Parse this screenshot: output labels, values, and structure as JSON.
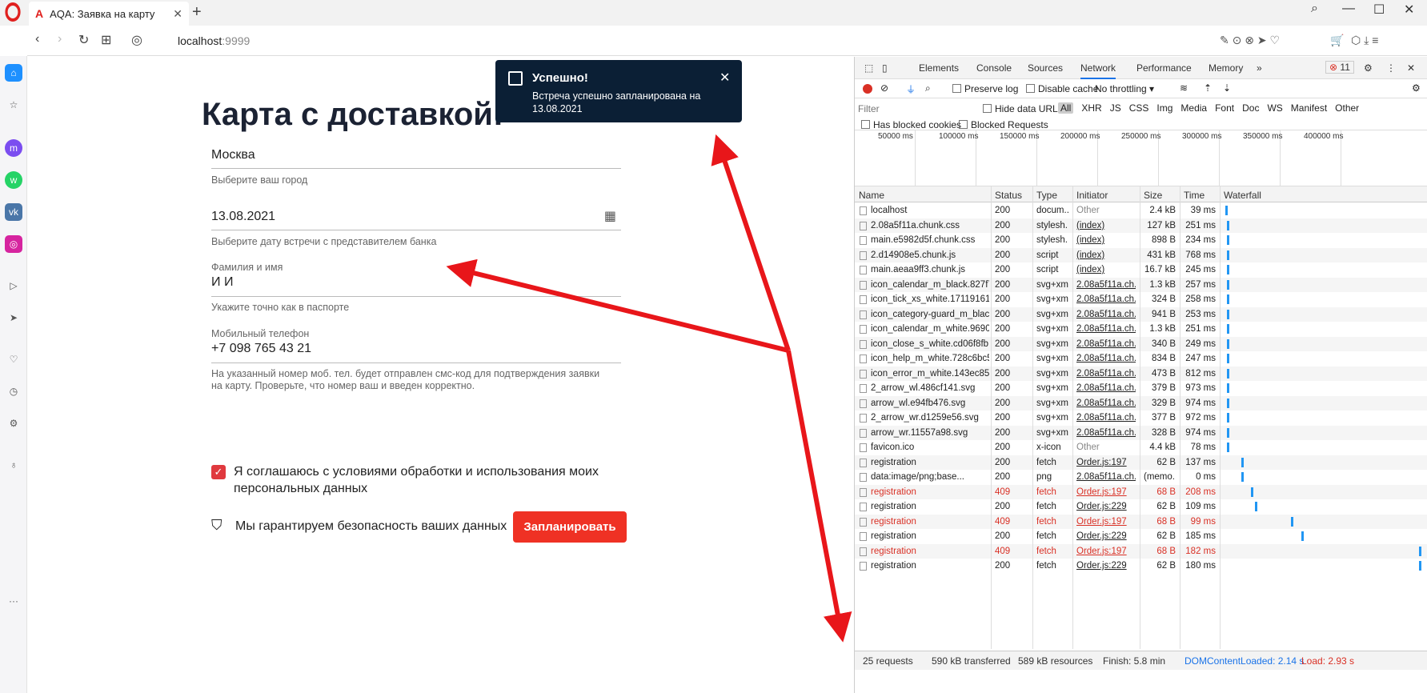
{
  "browser": {
    "tab_title": "AQA: Заявка на карту",
    "tab_close": "✕",
    "new_tab": "+",
    "url_host": "localhost",
    "url_port": ":9999"
  },
  "form": {
    "title": "Карта с доставкой!",
    "city_value": "Москва",
    "city_hint": "Выберите ваш город",
    "date_value": "13.08.2021",
    "date_hint": "Выберите дату встречи с представителем банка",
    "name_label": "Фамилия и имя",
    "name_value": "И И",
    "name_hint": "Укажите точно как в паспорте",
    "phone_label": "Мобильный телефон",
    "phone_value": "+7 098 765 43 21",
    "phone_hint": "На указанный номер моб. тел. будет отправлен смс-код для подтверждения заявки на карту. Проверьте, что номер ваш и введен корректно.",
    "agree_text": "Я соглашаюсь с условиями обработки и использования моих персональных данных",
    "secure_text": "Мы гарантируем безопасность ваших данных",
    "submit_label": "Запланировать"
  },
  "toast": {
    "title": "Успешно!",
    "message": "Встреча успешно запланирована на 13.08.2021"
  },
  "devtools": {
    "tabs": [
      "Elements",
      "Console",
      "Sources",
      "Network",
      "Performance",
      "Memory"
    ],
    "active_tab": "Network",
    "more": "»",
    "errors_count": "11",
    "preserve_log": "Preserve log",
    "disable_cache": "Disable cache",
    "throttling": "No throttling",
    "filter_placeholder": "Filter",
    "hide_data_urls": "Hide data URLs",
    "types": [
      "All",
      "XHR",
      "JS",
      "CSS",
      "Img",
      "Media",
      "Font",
      "Doc",
      "WS",
      "Manifest",
      "Other"
    ],
    "has_blocked_cookies": "Has blocked cookies",
    "blocked_requests": "Blocked Requests",
    "overview_ticks": [
      "50000 ms",
      "100000 ms",
      "150000 ms",
      "200000 ms",
      "250000 ms",
      "300000 ms",
      "350000 ms",
      "400000 ms"
    ],
    "columns": [
      "Name",
      "Status",
      "Type",
      "Initiator",
      "Size",
      "Time",
      "Waterfall"
    ],
    "rows": [
      {
        "name": "localhost",
        "status": "200",
        "type": "docum...",
        "initiator": "Other",
        "size": "2.4 kB",
        "time": "39 ms",
        "err": false,
        "link": false,
        "wf": 0.01
      },
      {
        "name": "2.08a5f11a.chunk.css",
        "status": "200",
        "type": "stylesh...",
        "initiator": "(index)",
        "size": "127 kB",
        "time": "251 ms",
        "err": false,
        "link": true,
        "wf": 0.02
      },
      {
        "name": "main.e5982d5f.chunk.css",
        "status": "200",
        "type": "stylesh...",
        "initiator": "(index)",
        "size": "898 B",
        "time": "234 ms",
        "err": false,
        "link": true,
        "wf": 0.02
      },
      {
        "name": "2.d14908e5.chunk.js",
        "status": "200",
        "type": "script",
        "initiator": "(index)",
        "size": "431 kB",
        "time": "768 ms",
        "err": false,
        "link": true,
        "wf": 0.02
      },
      {
        "name": "main.aeaa9ff3.chunk.js",
        "status": "200",
        "type": "script",
        "initiator": "(index)",
        "size": "16.7 kB",
        "time": "245 ms",
        "err": false,
        "link": true,
        "wf": 0.02
      },
      {
        "name": "icon_calendar_m_black.827f7...",
        "status": "200",
        "type": "svg+xml",
        "initiator": "2.08a5f11a.ch...",
        "size": "1.3 kB",
        "time": "257 ms",
        "err": false,
        "link": true,
        "wf": 0.02
      },
      {
        "name": "icon_tick_xs_white.17119161...",
        "status": "200",
        "type": "svg+xml",
        "initiator": "2.08a5f11a.ch...",
        "size": "324 B",
        "time": "258 ms",
        "err": false,
        "link": true,
        "wf": 0.02
      },
      {
        "name": "icon_category-guard_m_blac...",
        "status": "200",
        "type": "svg+xml",
        "initiator": "2.08a5f11a.ch...",
        "size": "941 B",
        "time": "253 ms",
        "err": false,
        "link": true,
        "wf": 0.02
      },
      {
        "name": "icon_calendar_m_white.9690e...",
        "status": "200",
        "type": "svg+xml",
        "initiator": "2.08a5f11a.ch...",
        "size": "1.3 kB",
        "time": "251 ms",
        "err": false,
        "link": true,
        "wf": 0.02
      },
      {
        "name": "icon_close_s_white.cd06f8fb.s...",
        "status": "200",
        "type": "svg+xml",
        "initiator": "2.08a5f11a.ch...",
        "size": "340 B",
        "time": "249 ms",
        "err": false,
        "link": true,
        "wf": 0.02
      },
      {
        "name": "icon_help_m_white.728c6bc5....",
        "status": "200",
        "type": "svg+xml",
        "initiator": "2.08a5f11a.ch...",
        "size": "834 B",
        "time": "247 ms",
        "err": false,
        "link": true,
        "wf": 0.02
      },
      {
        "name": "icon_error_m_white.143ec85a...",
        "status": "200",
        "type": "svg+xml",
        "initiator": "2.08a5f11a.ch...",
        "size": "473 B",
        "time": "812 ms",
        "err": false,
        "link": true,
        "wf": 0.02
      },
      {
        "name": "2_arrow_wl.486cf141.svg",
        "status": "200",
        "type": "svg+xml",
        "initiator": "2.08a5f11a.ch...",
        "size": "379 B",
        "time": "973 ms",
        "err": false,
        "link": true,
        "wf": 0.02
      },
      {
        "name": "arrow_wl.e94fb476.svg",
        "status": "200",
        "type": "svg+xml",
        "initiator": "2.08a5f11a.ch...",
        "size": "329 B",
        "time": "974 ms",
        "err": false,
        "link": true,
        "wf": 0.02
      },
      {
        "name": "2_arrow_wr.d1259e56.svg",
        "status": "200",
        "type": "svg+xml",
        "initiator": "2.08a5f11a.ch...",
        "size": "377 B",
        "time": "972 ms",
        "err": false,
        "link": true,
        "wf": 0.02
      },
      {
        "name": "arrow_wr.11557a98.svg",
        "status": "200",
        "type": "svg+xml",
        "initiator": "2.08a5f11a.ch...",
        "size": "328 B",
        "time": "974 ms",
        "err": false,
        "link": true,
        "wf": 0.02
      },
      {
        "name": "favicon.ico",
        "status": "200",
        "type": "x-icon",
        "initiator": "Other",
        "size": "4.4 kB",
        "time": "78 ms",
        "err": false,
        "link": false,
        "wf": 0.02
      },
      {
        "name": "registration",
        "status": "200",
        "type": "fetch",
        "initiator": "Order.js:197",
        "size": "62 B",
        "time": "137 ms",
        "err": false,
        "link": true,
        "wf": 0.09
      },
      {
        "name": "data:image/png;base...",
        "status": "200",
        "type": "png",
        "initiator": "2.08a5f11a.ch...",
        "size": "(memo...",
        "time": "0 ms",
        "err": false,
        "link": true,
        "wf": 0.09
      },
      {
        "name": "registration",
        "status": "409",
        "type": "fetch",
        "initiator": "Order.js:197",
        "size": "68 B",
        "time": "208 ms",
        "err": true,
        "link": true,
        "wf": 0.14
      },
      {
        "name": "registration",
        "status": "200",
        "type": "fetch",
        "initiator": "Order.js:229",
        "size": "62 B",
        "time": "109 ms",
        "err": false,
        "link": true,
        "wf": 0.16
      },
      {
        "name": "registration",
        "status": "409",
        "type": "fetch",
        "initiator": "Order.js:197",
        "size": "68 B",
        "time": "99 ms",
        "err": true,
        "link": true,
        "wf": 0.34
      },
      {
        "name": "registration",
        "status": "200",
        "type": "fetch",
        "initiator": "Order.js:229",
        "size": "62 B",
        "time": "185 ms",
        "err": false,
        "link": true,
        "wf": 0.39
      },
      {
        "name": "registration",
        "status": "409",
        "type": "fetch",
        "initiator": "Order.js:197",
        "size": "68 B",
        "time": "182 ms",
        "err": true,
        "link": true,
        "wf": 0.98
      },
      {
        "name": "registration",
        "status": "200",
        "type": "fetch",
        "initiator": "Order.js:229",
        "size": "62 B",
        "time": "180 ms",
        "err": false,
        "link": true,
        "wf": 0.98
      }
    ],
    "summary": {
      "requests": "25 requests",
      "transferred": "590 kB transferred",
      "resources": "589 kB resources",
      "finish": "Finish: 5.8 min",
      "dcl": "DOMContentLoaded: 2.14 s",
      "load": "Load: 2.93 s"
    }
  }
}
